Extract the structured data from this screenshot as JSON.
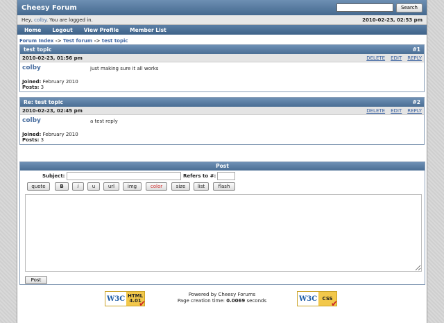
{
  "header": {
    "site_title": "Cheesy Forum",
    "search_placeholder": "",
    "search_button": "Search"
  },
  "userbar": {
    "greeting_prefix": "Hey, ",
    "username": "colby",
    "greeting_suffix": ". You are logged in.",
    "datetime": "2010-02-23, 02:53 pm"
  },
  "nav": {
    "items": [
      {
        "label": "Home"
      },
      {
        "label": "Logout"
      },
      {
        "label": "View Profile"
      },
      {
        "label": "Member List"
      }
    ]
  },
  "breadcrumb": {
    "forum_index": "Forum Index",
    "sep1": " -> ",
    "forum": "Test forum",
    "sep2": " -> ",
    "topic": "test topic"
  },
  "posts": [
    {
      "title": "test topic",
      "number": "#1",
      "date": "2010-02-23, 01:56 pm",
      "delete": "DELETE",
      "edit": "EDIT",
      "reply": "REPLY",
      "author": "colby",
      "message": "just making sure it all works",
      "joined_label": "Joined:",
      "joined": " February 2010",
      "posts_label": "Posts:",
      "posts": " 3"
    },
    {
      "title": "Re: test topic",
      "number": "#2",
      "date": "2010-02-23, 02:45 pm",
      "delete": "DELETE",
      "edit": "EDIT",
      "reply": "REPLY",
      "author": "colby",
      "message": "a test reply",
      "joined_label": "Joined:",
      "joined": " February 2010",
      "posts_label": "Posts:",
      "posts": " 3"
    }
  ],
  "reply_form": {
    "heading": "Post",
    "subject_label": "Subject:",
    "subject_value": "",
    "refers_label": "Refers to #:",
    "refers_value": "",
    "toolbar": [
      "quote",
      "B",
      "i",
      "u",
      "url",
      "img",
      "color",
      "size",
      "list",
      "flash"
    ],
    "submit": "Post"
  },
  "footer": {
    "powered": "Powered by Cheesy Forums",
    "creation_prefix": "Page creation time: ",
    "creation_time": "0.0069",
    "creation_suffix": " seconds",
    "badge_html_w3": "W3C",
    "badge_html_std": "HTML 4.01",
    "badge_css_w3": "W3C",
    "badge_css_std": "CSS"
  },
  "colors": {
    "header": "#4a6e94",
    "link": "#3c63a0",
    "color_button": "#d03030"
  }
}
